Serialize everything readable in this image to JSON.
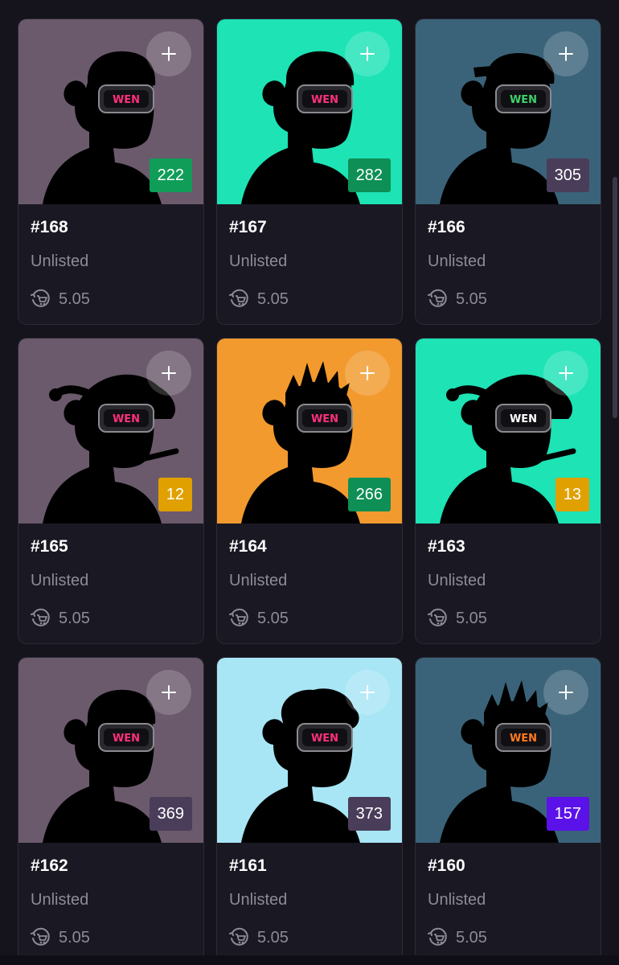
{
  "cards": [
    {
      "title": "#168",
      "status": "Unlisted",
      "price": "5.05",
      "rank": "222",
      "bg": "#6b5a6c",
      "rank_color": "#0f9d58",
      "lens_color": "#ff2f7d",
      "hat": "beanie",
      "add_icon": "plus-icon"
    },
    {
      "title": "#167",
      "status": "Unlisted",
      "price": "5.05",
      "rank": "282",
      "bg": "#1de3b5",
      "rank_color": "#0e8f55",
      "lens_color": "#ff2f7d",
      "hat": "beanie",
      "add_icon": "plus-icon"
    },
    {
      "title": "#166",
      "status": "Unlisted",
      "price": "5.05",
      "rank": "305",
      "bg": "#3a6379",
      "rank_color": "#4a3d5a",
      "lens_color": "#3fd06a",
      "hat": "cap",
      "add_icon": "plus-icon"
    },
    {
      "title": "#165",
      "status": "Unlisted",
      "price": "5.05",
      "rank": "12",
      "bg": "#6b5a6c",
      "rank_color": "#e0a000",
      "lens_color": "#ff2f7d",
      "hat": "santa",
      "add_icon": "plus-icon"
    },
    {
      "title": "#164",
      "status": "Unlisted",
      "price": "5.05",
      "rank": "266",
      "bg": "#f29a2e",
      "rank_color": "#0e8f55",
      "lens_color": "#ff2f7d",
      "hat": "spiky",
      "add_icon": "plus-icon"
    },
    {
      "title": "#163",
      "status": "Unlisted",
      "price": "5.05",
      "rank": "13",
      "bg": "#1de3b5",
      "rank_color": "#e0a000",
      "lens_color": "#ffffff",
      "hat": "santa",
      "add_icon": "plus-icon"
    },
    {
      "title": "#162",
      "status": "Unlisted",
      "price": "5.05",
      "rank": "369",
      "bg": "#6b5a6c",
      "rank_color": "#4a3d5a",
      "lens_color": "#ff2f7d",
      "hat": "beanie",
      "add_icon": "plus-icon"
    },
    {
      "title": "#161",
      "status": "Unlisted",
      "price": "5.05",
      "rank": "373",
      "bg": "#a8e6f5",
      "rank_color": "#4a3d5a",
      "lens_color": "#ff2f7d",
      "hat": "curly",
      "add_icon": "plus-icon"
    },
    {
      "title": "#160",
      "status": "Unlisted",
      "price": "5.05",
      "rank": "157",
      "bg": "#3a6379",
      "rank_color": "#5a12e8",
      "lens_color": "#ff7a1f",
      "hat": "spiky",
      "add_icon": "plus-icon"
    }
  ],
  "goggle_text": "WEN",
  "price_icon": "cart-refresh-icon"
}
